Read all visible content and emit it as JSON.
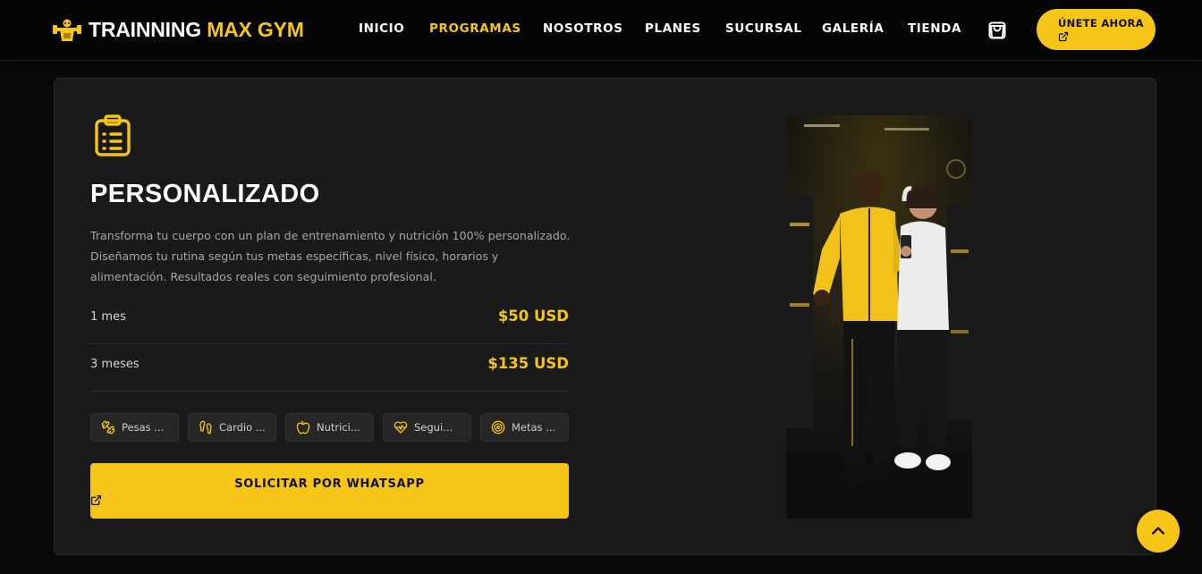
{
  "brand": {
    "name_white": "TRAINNING",
    "name_yellow": "MAX GYM",
    "logo_icon": "bodybuilder-logo-icon"
  },
  "nav": {
    "items": [
      {
        "label": "INICIO",
        "active": false
      },
      {
        "label": "PROGRAMAS",
        "active": true
      },
      {
        "label": "NOSOTROS",
        "active": false
      },
      {
        "label": "PLANES",
        "active": false
      },
      {
        "label": "SUCURSAL",
        "active": false
      },
      {
        "label": "GALERÍA",
        "active": false
      },
      {
        "label": "TIENDA",
        "active": false
      }
    ],
    "cart_icon": "shopping-bag-icon",
    "join_label": "ÚNETE AHORA",
    "join_icon": "external-link-icon"
  },
  "program": {
    "icon": "clipboard-list-icon",
    "title": "PERSONALIZADO",
    "description": "Transforma tu cuerpo con un plan de entrenamiento y nutrición 100% personalizado. Diseñamos tu rutina según tus metas específicas, nivel físico, horarios y alimentación. Resultados reales con seguimiento profesional.",
    "prices": [
      {
        "duration": "1 mes",
        "amount": "$50 USD"
      },
      {
        "duration": "3 meses",
        "amount": "$135 USD"
      }
    ],
    "features": [
      {
        "label": "Pesas ...",
        "icon": "dumbbell-icon"
      },
      {
        "label": "Cardio ...",
        "icon": "footprints-icon"
      },
      {
        "label": "Nutrici...",
        "icon": "apple-icon"
      },
      {
        "label": "Segui...",
        "icon": "heart-pulse-icon"
      },
      {
        "label": "Metas ...",
        "icon": "target-icon"
      }
    ],
    "cta_label": "SOLICITAR POR WHATSAPP",
    "cta_icon": "external-link-icon",
    "photo": "trainer-and-client-photo"
  },
  "scroll_top_icon": "chevron-up-icon",
  "colors": {
    "accent": "#f5c518",
    "background": "#0a0a0a",
    "card": "#1a1a1a",
    "muted_text": "#a6a6a6"
  }
}
